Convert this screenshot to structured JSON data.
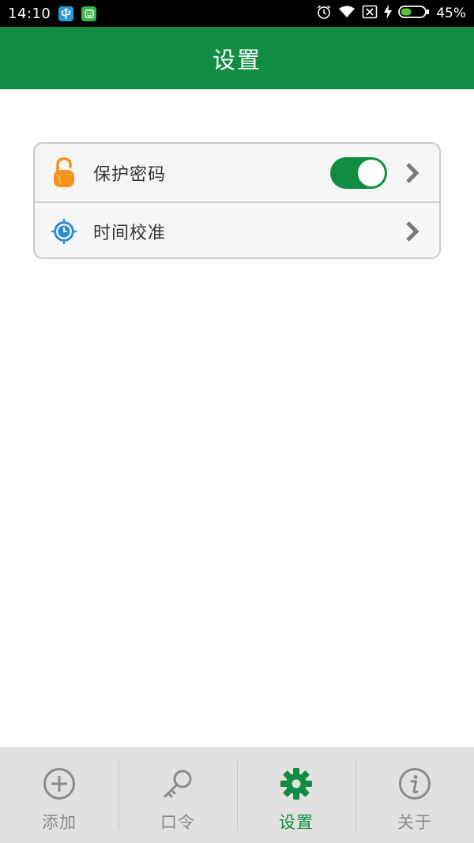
{
  "status_bar": {
    "time": "14:10",
    "icons": [
      "usb-icon",
      "android-icon",
      "alarm-icon",
      "wifi-icon",
      "sim-off-icon",
      "charging-icon",
      "battery-icon"
    ],
    "battery_percent": "45%",
    "battery_level": 0.45
  },
  "header": {
    "title": "设置"
  },
  "settings": {
    "items": [
      {
        "label": "保护密码",
        "icon": "lock-icon",
        "toggle_on": true
      },
      {
        "label": "时间校准",
        "icon": "clock-target-icon"
      }
    ]
  },
  "bottom_nav": {
    "items": [
      {
        "label": "添加",
        "icon": "add-circle-icon",
        "active": false
      },
      {
        "label": "口令",
        "icon": "key-icon",
        "active": false
      },
      {
        "label": "设置",
        "icon": "gear-icon",
        "active": true
      },
      {
        "label": "关于",
        "icon": "info-icon",
        "active": false
      }
    ]
  },
  "colors": {
    "primary": "#108c43",
    "header_text": "#ffffff",
    "lock_orange": "#f7941d",
    "clock_blue": "#2b8ad6",
    "nav_inactive": "#8a8a8a",
    "nav_background": "#e1e1e1"
  }
}
